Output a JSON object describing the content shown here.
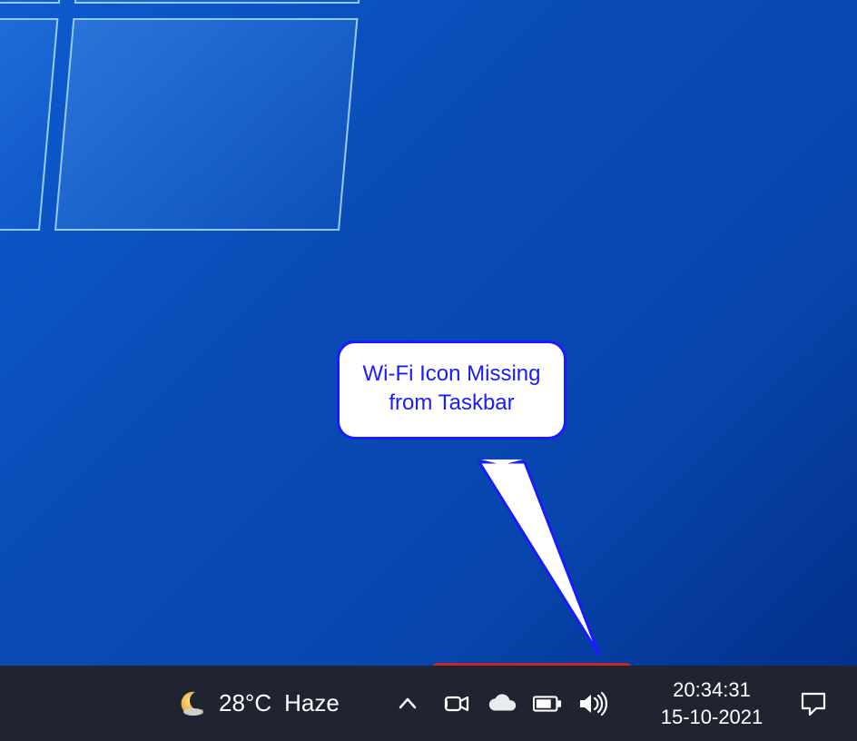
{
  "callout": {
    "text": "Wi-Fi Icon Missing from Taskbar"
  },
  "weather": {
    "temperature": "28°C",
    "condition": "Haze"
  },
  "clock": {
    "time": "20:34:31",
    "date": "15-10-2021"
  },
  "highlight": {
    "color": "#c62828"
  },
  "tray_icons": [
    "meet-now-icon",
    "onedrive-icon",
    "battery-icon",
    "volume-icon"
  ]
}
